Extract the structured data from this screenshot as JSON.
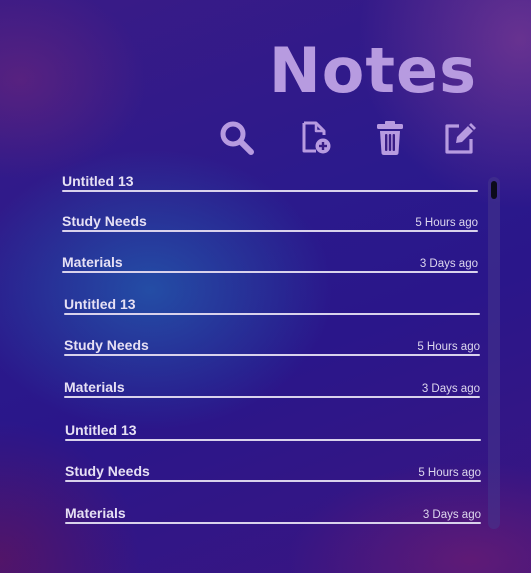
{
  "app": {
    "title": "Notes"
  },
  "toolbar": [
    {
      "name": "search-button",
      "icon": "search-icon"
    },
    {
      "name": "new-note-button",
      "icon": "new-file-icon"
    },
    {
      "name": "delete-button",
      "icon": "trash-icon"
    },
    {
      "name": "edit-button",
      "icon": "edit-icon"
    }
  ],
  "notes": [
    {
      "title": "Untitled 13",
      "time": ""
    },
    {
      "title": "Study Needs",
      "time": "5 Hours ago"
    },
    {
      "title": "Materials",
      "time": "3 Days ago"
    },
    {
      "title": "Untitled 13",
      "time": ""
    },
    {
      "title": "Study Needs",
      "time": "5 Hours ago"
    },
    {
      "title": "Materials",
      "time": "3 Days ago"
    },
    {
      "title": "Untitled 13",
      "time": ""
    },
    {
      "title": "Study Needs",
      "time": "5 Hours ago"
    },
    {
      "title": "Materials",
      "time": "3 Days ago"
    }
  ],
  "colors": {
    "accent": "#b79be0",
    "text": "#e6e0f4",
    "rule": "#d9d2ec",
    "scroll_thumb": "#0c0b1a"
  }
}
